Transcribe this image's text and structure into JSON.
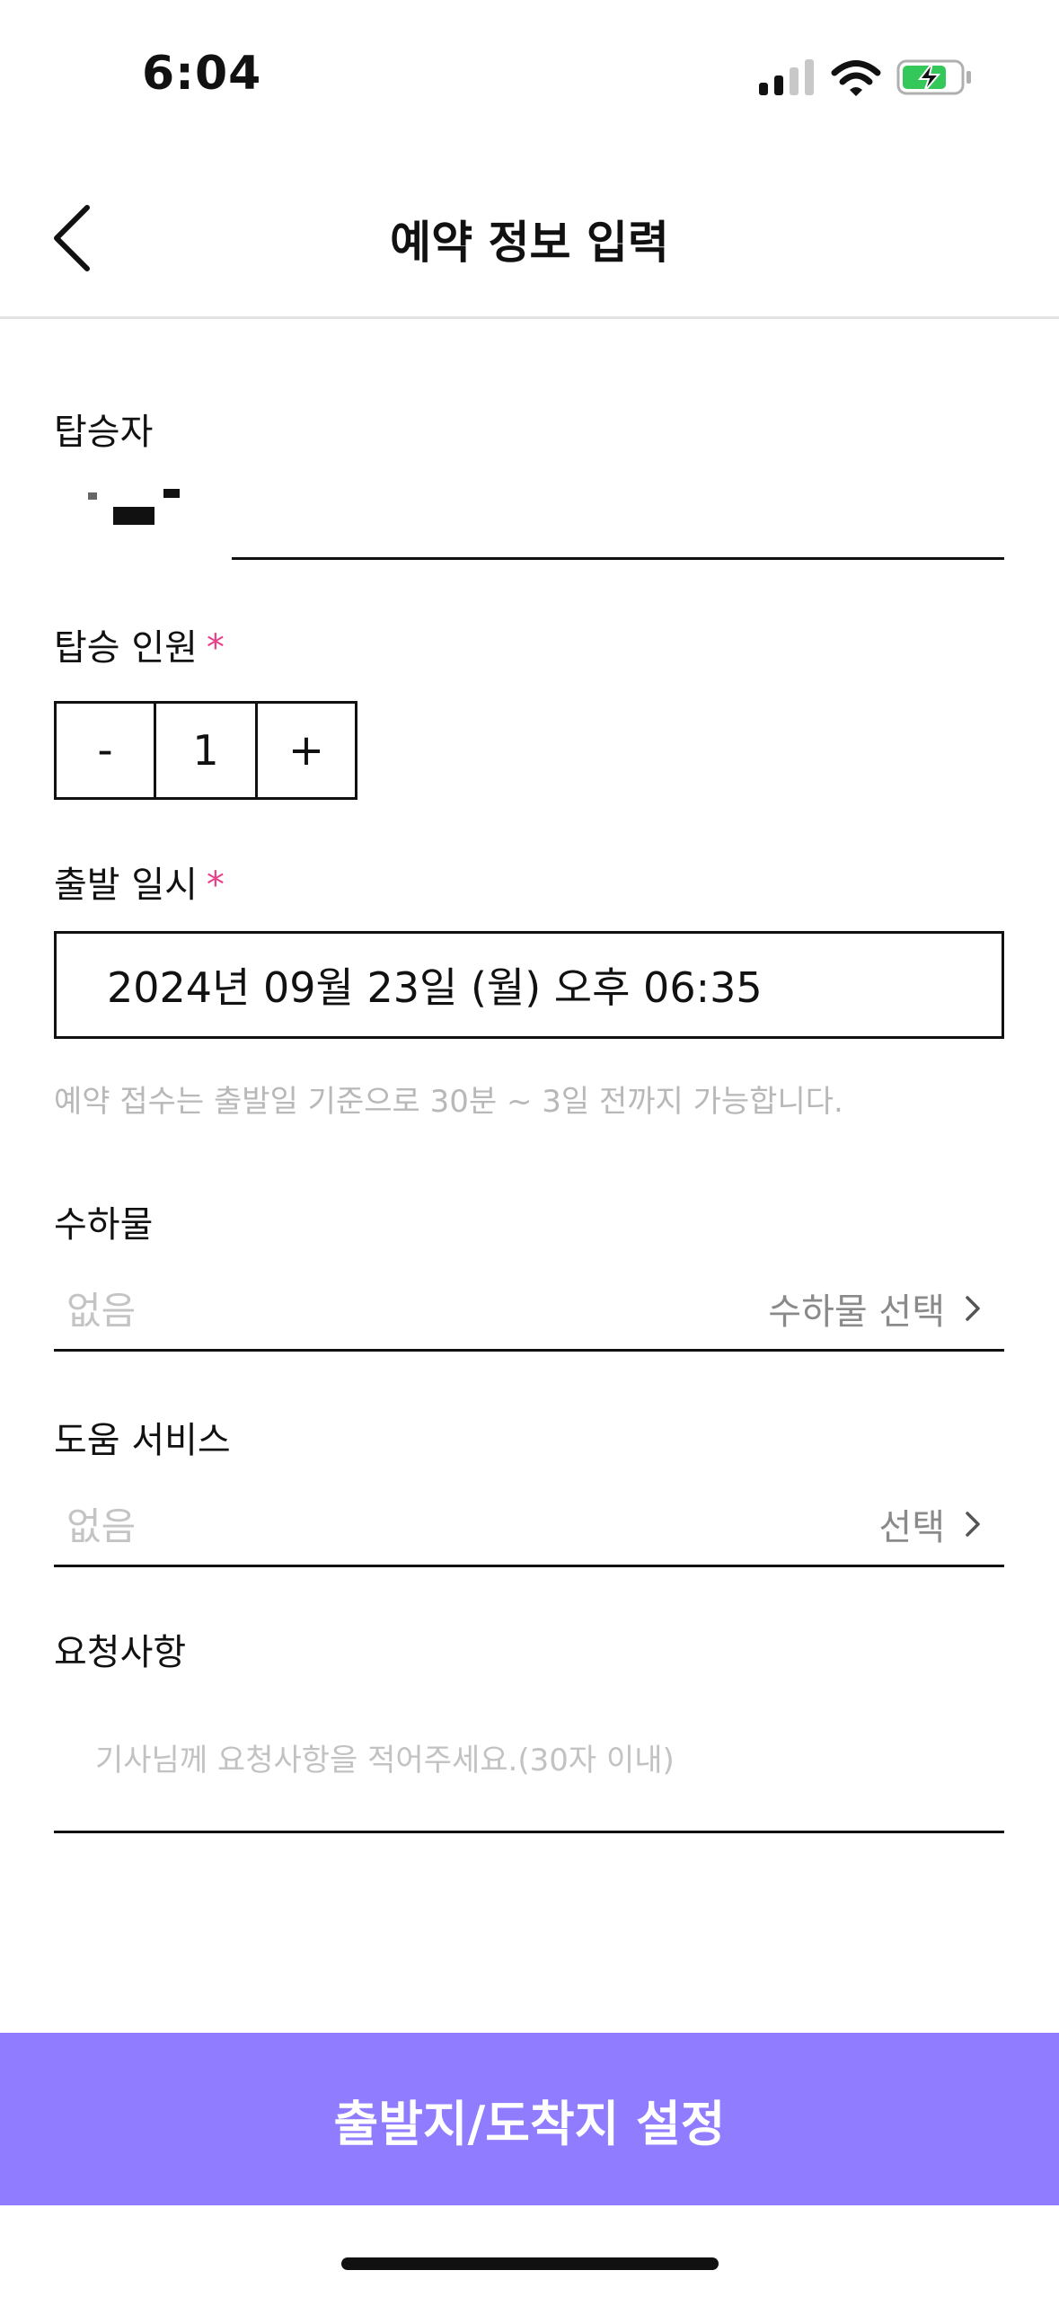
{
  "status_bar": {
    "time": "6:04"
  },
  "header": {
    "title": "예약 정보 입력"
  },
  "form": {
    "passenger": {
      "label": "탑승자"
    },
    "passenger_count": {
      "label": "탑승 인원",
      "required_mark": "*",
      "minus_label": "-",
      "value": "1",
      "plus_label": "+"
    },
    "departure_datetime": {
      "label": "출발 일시",
      "required_mark": "*",
      "value": "2024년 09월 23일 (월) 오후 06:35",
      "hint": "예약 접수는 출발일 기준으로 30분 ~ 3일 전까지 가능합니다."
    },
    "luggage": {
      "label": "수하물",
      "value": "없음",
      "action_label": "수하물 선택"
    },
    "assist_service": {
      "label": "도움 서비스",
      "value": "없음",
      "action_label": "선택"
    },
    "request": {
      "label": "요청사항",
      "placeholder": "기사님께 요청사항을 적어주세요.(30자 이내)"
    }
  },
  "footer": {
    "cta_label": "출발지/도착지 설정"
  },
  "colors": {
    "accent": "#8f7cff",
    "required": "#e8418a",
    "hint": "#b8b8b8",
    "battery_fill": "#34c759"
  },
  "icons": {
    "back": "chevron-left-icon",
    "signal": "cellular-signal-icon",
    "wifi": "wifi-icon",
    "battery": "battery-charging-icon",
    "select_arrow": "chevron-right-icon"
  }
}
